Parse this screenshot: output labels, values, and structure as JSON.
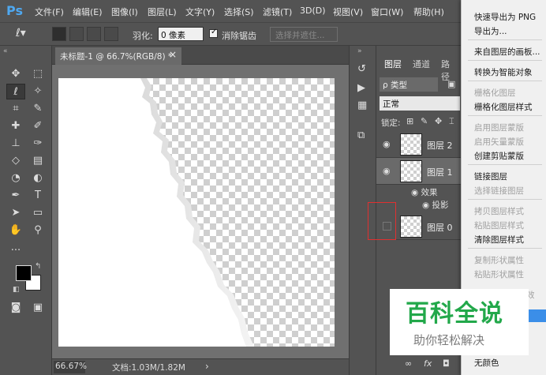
{
  "app": {
    "logo": "Ps",
    "menus": [
      "文件(F)",
      "编辑(E)",
      "图像(I)",
      "图层(L)",
      "文字(Y)",
      "选择(S)",
      "滤镜(T)",
      "3D(D)",
      "视图(V)",
      "窗口(W)",
      "帮助(H)"
    ]
  },
  "options_bar": {
    "feather_label": "羽化:",
    "feather_value": "0 像素",
    "antialias_label": "消除锯齿",
    "select_subject_label": "选择并遮住..."
  },
  "document": {
    "tab_title": "未标题-1 @ 66.7%(RGB/8) *",
    "close_glyph": "×"
  },
  "status": {
    "zoom": "66.67%",
    "doc_info": "文档:1.03M/1.82M",
    "arrow": "›"
  },
  "layers_panel": {
    "tabs": [
      "图层",
      "通道",
      "路径"
    ],
    "filter_label": "ρ 类型",
    "blend_mode": "正常",
    "lock_label": "锁定:",
    "layers": [
      {
        "name": "图层 2",
        "visible": true
      },
      {
        "name": "图层 1",
        "visible": true,
        "selected": true
      },
      {
        "name": "图层 0",
        "visible": false
      }
    ],
    "effects_label": "效果",
    "effect_item": "投影",
    "bottom_icons": [
      "∞",
      "fx",
      "◘"
    ]
  },
  "context_menu": {
    "items": [
      {
        "label": "快速导出为 PNG",
        "disabled": false
      },
      {
        "label": "导出为...",
        "disabled": false
      },
      {
        "label": "来自图层的画板...",
        "disabled": false
      },
      {
        "label": "转换为智能对象",
        "disabled": false
      },
      {
        "label": "栅格化图层",
        "disabled": true
      },
      {
        "label": "栅格化图层样式",
        "disabled": false
      },
      {
        "label": "启用图层蒙版",
        "disabled": true
      },
      {
        "label": "启用矢量蒙版",
        "disabled": true
      },
      {
        "label": "创建剪贴蒙版",
        "disabled": false
      },
      {
        "label": "链接图层",
        "disabled": false
      },
      {
        "label": "选择链接图层",
        "disabled": true
      },
      {
        "label": "拷贝图层样式",
        "disabled": true
      },
      {
        "label": "粘贴图层样式",
        "disabled": true
      },
      {
        "label": "清除图层样式",
        "disabled": false
      },
      {
        "label": "复制形状属性",
        "disabled": true
      },
      {
        "label": "粘贴形状属性",
        "disabled": true
      },
      {
        "label": "无颜色",
        "disabled": false
      }
    ],
    "partial_right": "效"
  },
  "watermark": {
    "title": "百科全说",
    "subtitle": "助你轻松解决"
  },
  "colors": {
    "foreground": "#000000",
    "background": "#ffffff",
    "accent": "#22a84a",
    "highlight_red": "#e03030"
  }
}
